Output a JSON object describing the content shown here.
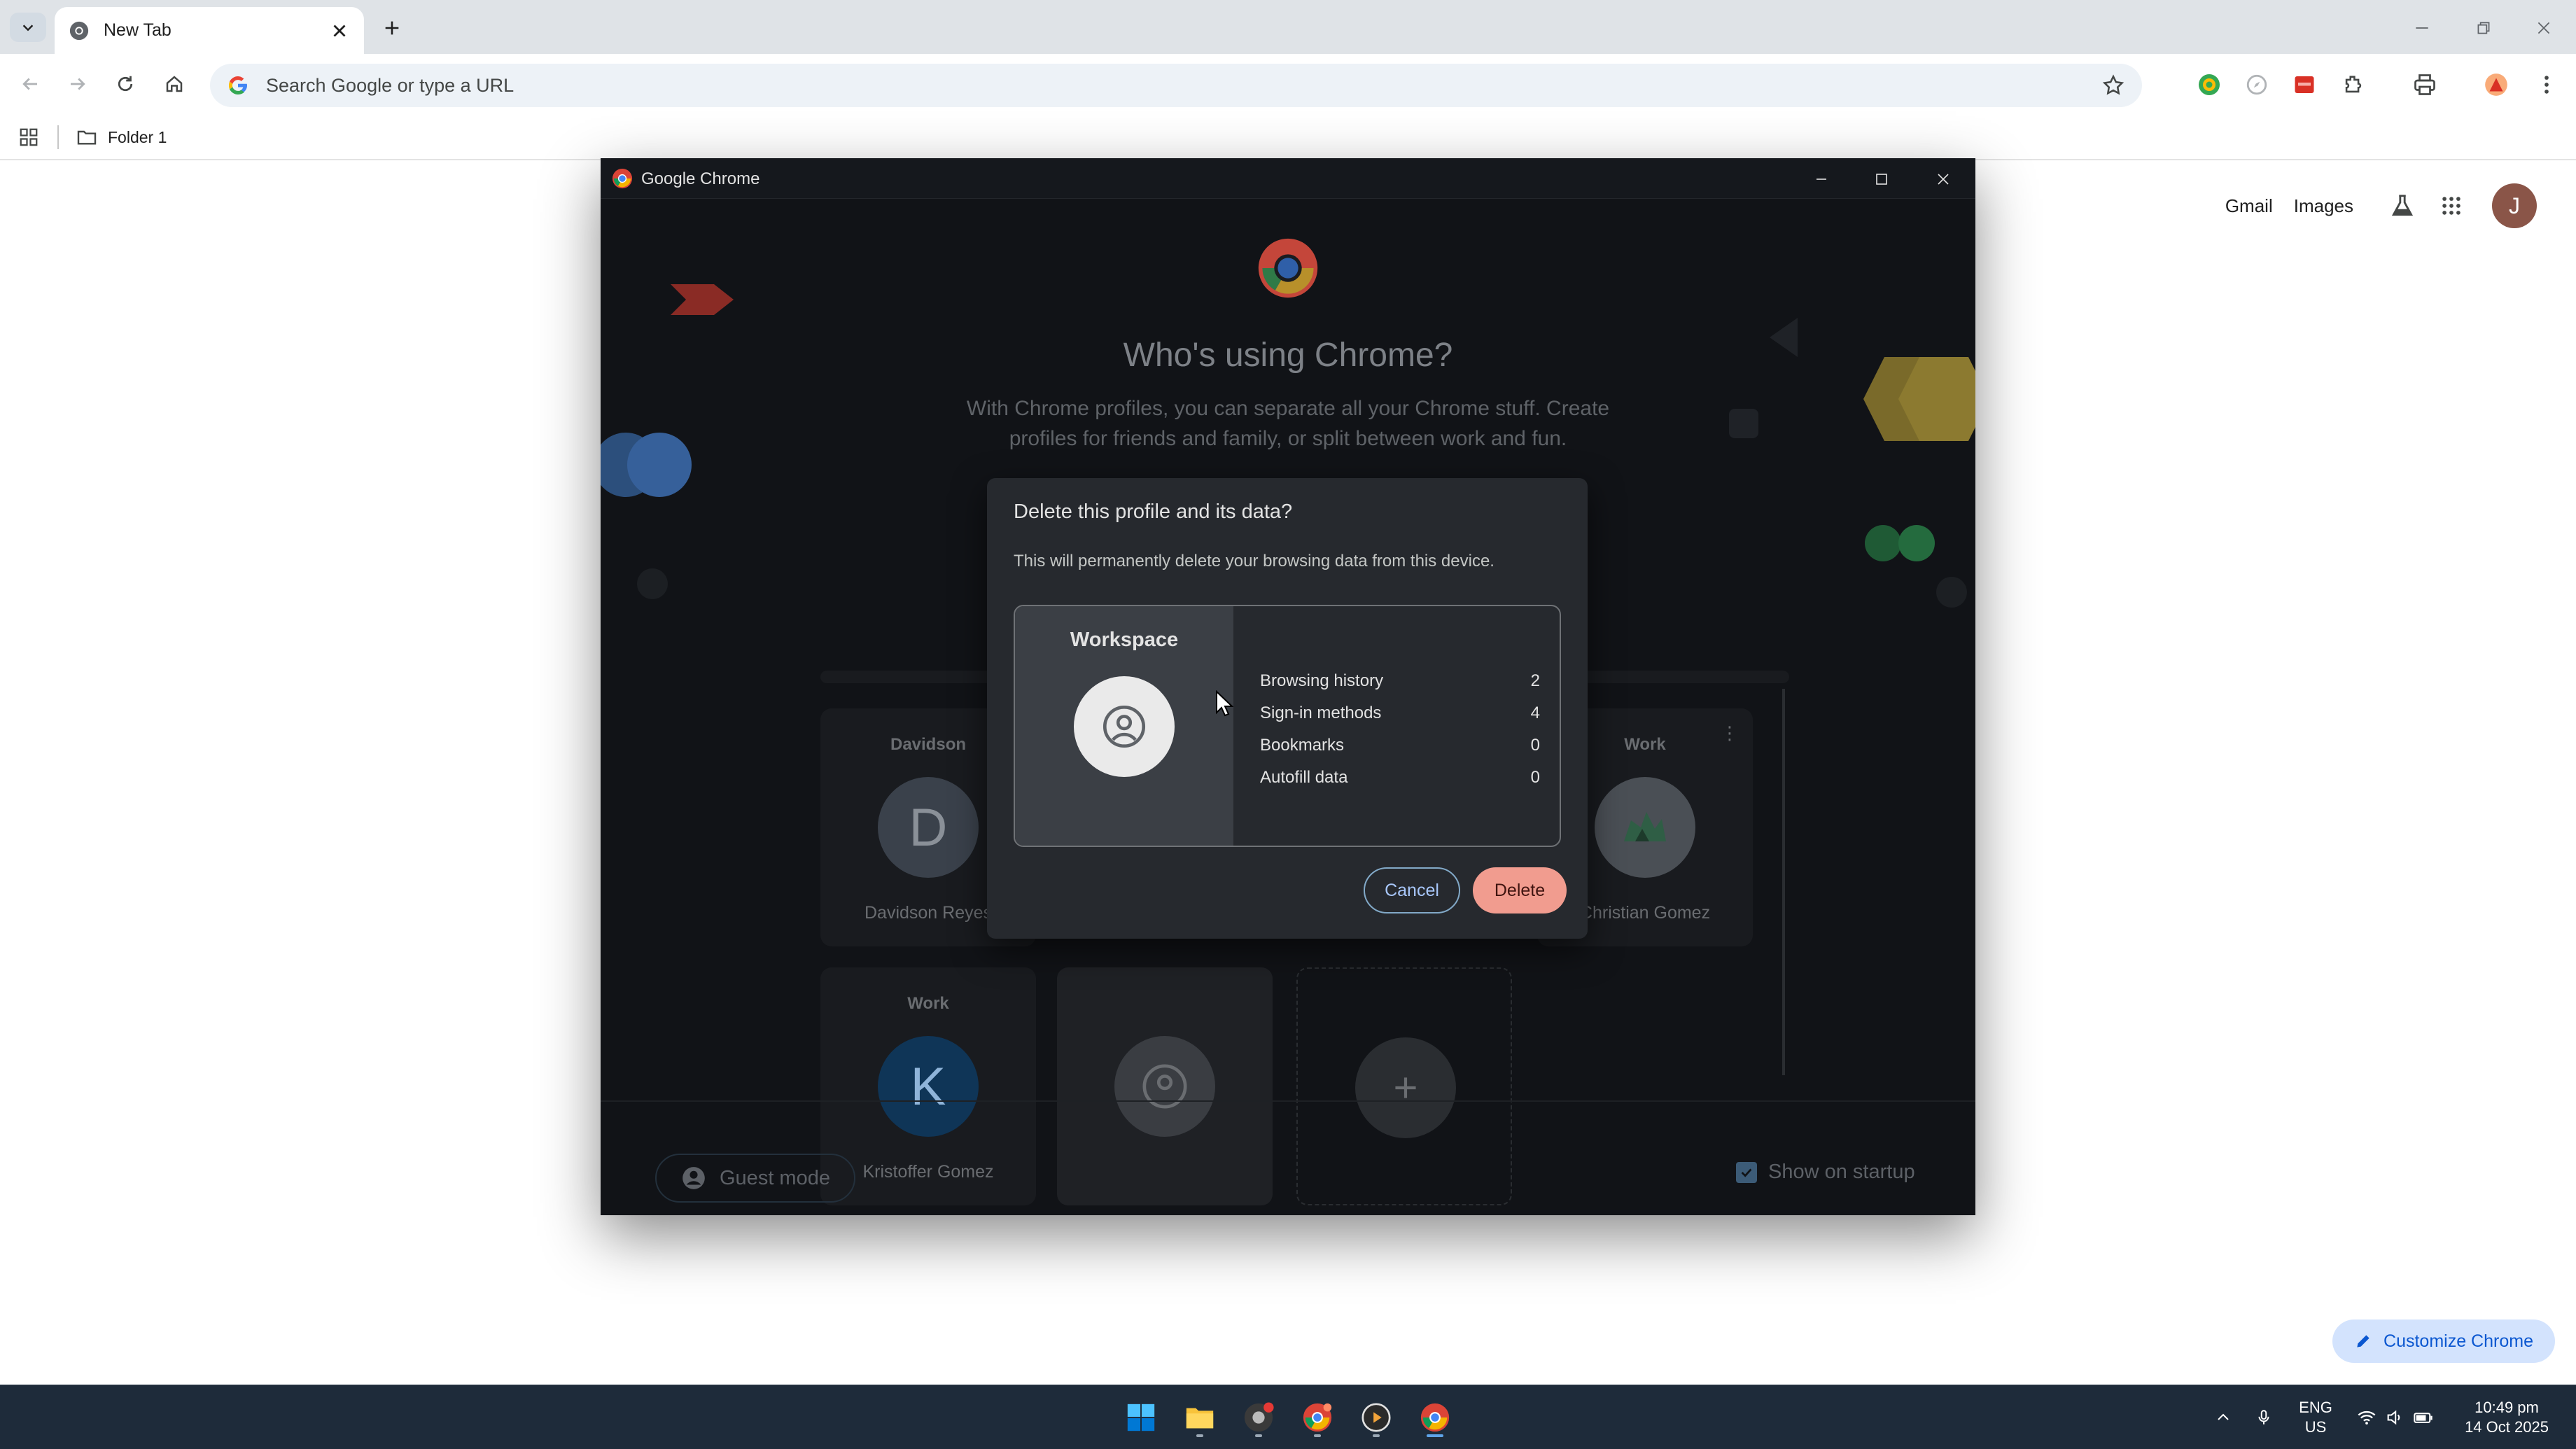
{
  "browser": {
    "tab_title": "New Tab",
    "omnibox_placeholder": "Search Google or type a URL",
    "bookmark_folder": "Folder 1"
  },
  "ntp": {
    "gmail": "Gmail",
    "images": "Images",
    "avatar_initial": "J",
    "customize_label": "Customize Chrome"
  },
  "picker": {
    "window_title": "Google Chrome",
    "heading": "Who's using Chrome?",
    "subheading": "With Chrome profiles, you can separate all your Chrome stuff. Create profiles for friends and family, or split between work and fun.",
    "profiles": [
      {
        "label": "Davidson",
        "initial": "D",
        "name": "Davidson Reyes",
        "color": "#3a414b"
      },
      {
        "label": "Work",
        "initial": "",
        "name": "Christian Gomez",
        "color": "#4a4f55"
      },
      {
        "label": "Work",
        "initial": "K",
        "name": "Kristoffer Gomez",
        "color": "#0f3557"
      }
    ],
    "guest_mode": "Guest mode",
    "show_on_startup": "Show on startup"
  },
  "dialog": {
    "title": "Delete this profile and its data?",
    "subtitle": "This will permanently delete your browsing data from this device.",
    "profile_name": "Workspace",
    "rows": [
      {
        "label": "Browsing history",
        "value": "2"
      },
      {
        "label": "Sign-in methods",
        "value": "4"
      },
      {
        "label": "Bookmarks",
        "value": "0"
      },
      {
        "label": "Autofill data",
        "value": "0"
      }
    ],
    "cancel": "Cancel",
    "delete": "Delete"
  },
  "taskbar": {
    "lang_top": "ENG",
    "lang_bottom": "US",
    "time": "10:49 pm",
    "date": "14 Oct 2025"
  },
  "colors": {
    "accent": "#0b57d0",
    "delete_button": "#f19c8f",
    "taskbar": "#1e2b3a"
  }
}
